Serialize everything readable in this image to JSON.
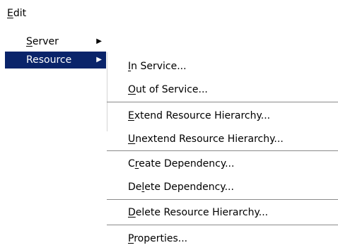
{
  "menubar": {
    "edit": {
      "mnemonic": "E",
      "rest": "dit"
    }
  },
  "edit_menu": {
    "items": [
      {
        "mnemonic": "S",
        "rest": "erver",
        "arrow": "▶"
      },
      {
        "label": "Resource",
        "arrow": "▶"
      }
    ]
  },
  "resource_submenu": {
    "items": [
      {
        "pre": "",
        "mnemonic": "I",
        "post": "n Service..."
      },
      {
        "pre": "",
        "mnemonic": "O",
        "post": "ut of Service..."
      },
      {
        "pre": "",
        "mnemonic": "E",
        "post": "xtend Resource Hierarchy..."
      },
      {
        "pre": "",
        "mnemonic": "U",
        "post": "nextend Resource Hierarchy..."
      },
      {
        "pre": "C",
        "mnemonic": "r",
        "post": "eate Dependency..."
      },
      {
        "pre": "De",
        "mnemonic": "l",
        "post": "ete Dependency..."
      },
      {
        "pre": "",
        "mnemonic": "D",
        "post": "elete Resource Hierarchy..."
      },
      {
        "pre": "",
        "mnemonic": "P",
        "post": "roperties..."
      }
    ]
  },
  "colors": {
    "highlight_bg": "#0a246a",
    "highlight_fg": "#ffffff"
  }
}
